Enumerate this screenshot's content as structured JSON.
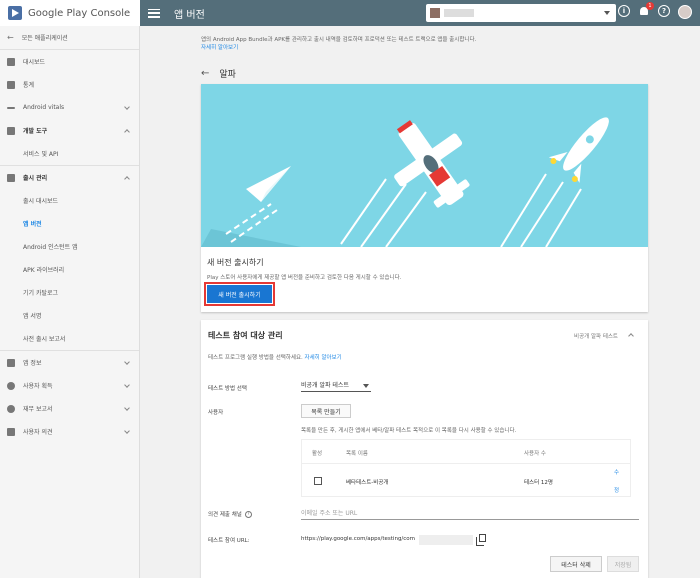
{
  "brand": {
    "name": "Google Play Console"
  },
  "appbar": {
    "title": "앱 버전"
  },
  "topbar": {
    "notification_count": "1",
    "help_icon": "?",
    "info_icon": "i"
  },
  "sidebar": {
    "back_label": "모든 애플리케이션",
    "items": [
      {
        "label": "대시보드",
        "icon": "dashboard-icon"
      },
      {
        "label": "통계",
        "icon": "stats-icon"
      },
      {
        "label": "Android vitals",
        "icon": "vitals-icon"
      },
      {
        "label": "개발 도구",
        "icon": "dev-tools-icon"
      },
      {
        "label": "서비스 및 API"
      },
      {
        "label": "출시 관리",
        "icon": "release-icon"
      },
      {
        "label": "출시 대시보드"
      },
      {
        "label": "앱 버전"
      },
      {
        "label": "Android 인스턴트 앱"
      },
      {
        "label": "APK 라이브러리"
      },
      {
        "label": "기기 카탈로그"
      },
      {
        "label": "앱 서명"
      },
      {
        "label": "사전 출시 보고서"
      },
      {
        "label": "앱 정보",
        "icon": "store-icon"
      },
      {
        "label": "사용자 획득",
        "icon": "user-add-icon"
      },
      {
        "label": "재무 보고서",
        "icon": "finance-icon"
      },
      {
        "label": "사용자 의견",
        "icon": "feedback-icon"
      }
    ]
  },
  "main": {
    "intro_text": "앱의 Android App Bundle과 APK를 관리하고 출시 내역을 검토하며 프로덕션 또는 테스트 트랙으로 앱을 출시합니다.",
    "learn_more": "자세히 알아보기",
    "page_title": "알파",
    "hero": {
      "title": "새 버전 출시하기",
      "description": "Play 스토어 사용자에게 제공할 앱 버전을 준비하고 검토한 다음 게시할 수 있습니다.",
      "button": "새 버전 출시하기"
    },
    "testers": {
      "title": "테스트 참여 대상 관리",
      "status": "비공개 알파 테스트",
      "description": "테스트 프로그램 실행 방법을 선택하세요.",
      "learn_more": "자세히 알아보기",
      "method_label": "테스트 방법 선택",
      "method_value": "비공개 알파 테스트",
      "users_label": "사용자",
      "create_list_button": "목록 만들기",
      "list_note": "목록을 만든 후, 게시한 앱에서 베타/알파 테스트 목적으로 이 목록을 다시 사용할 수 있습니다.",
      "table": {
        "headers": {
          "active": "활성",
          "list_name": "목록 이름",
          "user_count": "사용자 수"
        },
        "rows": [
          {
            "list_name": "베타테스트-비공개",
            "user_count": "테스터 12명",
            "edit_1": "수",
            "edit_2": "정"
          }
        ]
      },
      "feedback_label": "의견 제출 채널",
      "feedback_placeholder": "이메일 주소 또는 URL",
      "url_label": "테스트 참여 URL:",
      "url_value": "https://play.google.com/apps/testing/com",
      "delete_button": "테스터 삭제",
      "save_button": "저장됨"
    }
  }
}
